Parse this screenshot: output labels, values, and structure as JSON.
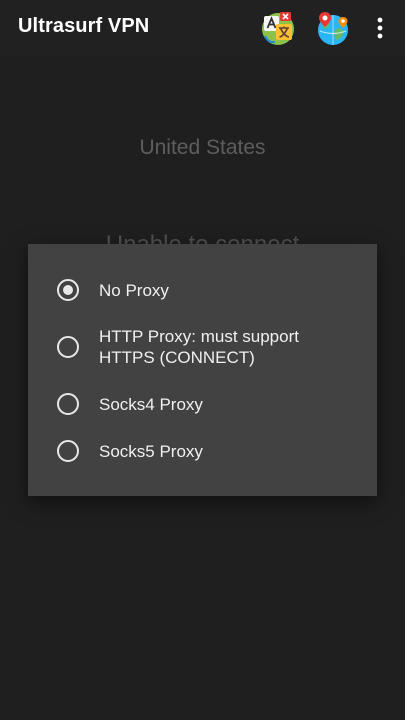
{
  "appbar": {
    "title": "Ultrasurf VPN",
    "icons": [
      "translate-icon",
      "globe-location-icon",
      "more-vert-icon"
    ]
  },
  "main": {
    "country": "United States",
    "status": "Unable to connect"
  },
  "dialog": {
    "options": [
      {
        "label": "No Proxy",
        "checked": true
      },
      {
        "label": "HTTP Proxy: must support HTTPS (CONNECT)",
        "checked": false
      },
      {
        "label": "Socks4 Proxy",
        "checked": false
      },
      {
        "label": "Socks5 Proxy",
        "checked": false
      }
    ]
  },
  "colors": {
    "appbar": "#212121",
    "background": "#1f1f1f",
    "dialog": "#424242",
    "radio": "#e8e8e8"
  }
}
